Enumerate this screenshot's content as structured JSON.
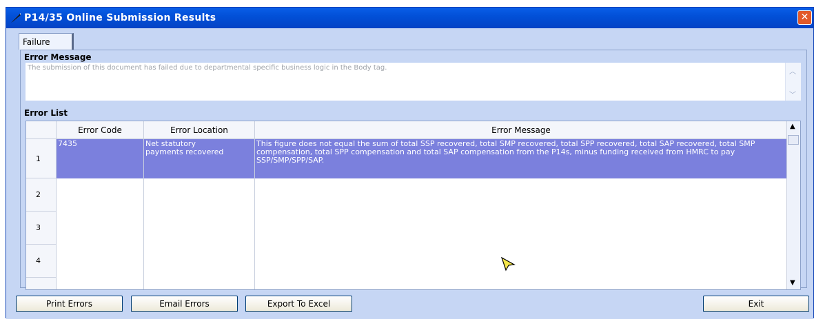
{
  "window": {
    "title": "P14/35 Online Submission Results",
    "close_label": "✕"
  },
  "tabs": [
    {
      "label": "Failure"
    }
  ],
  "error_message": {
    "label": "Error Message",
    "text": "The submission of this document has failed due to departmental specific business logic in the Body tag."
  },
  "error_list": {
    "label": "Error List",
    "columns": [
      "Error Code",
      "Error Location",
      "Error Message"
    ],
    "rows": [
      {
        "num": "1",
        "code": "7435",
        "location": "Net statutory payments recovered",
        "message": "This figure does not equal the sum of total SSP recovered, total SMP recovered, total SPP recovered, total SAP recovered, total SMP compensation, total SPP compensation and total SAP compensation from the P14s, minus funding received from HMRC to pay SSP/SMP/SPP/SAP."
      },
      {
        "num": "2",
        "code": "",
        "location": "",
        "message": ""
      },
      {
        "num": "3",
        "code": "",
        "location": "",
        "message": ""
      },
      {
        "num": "4",
        "code": "",
        "location": "",
        "message": ""
      }
    ]
  },
  "buttons": {
    "print": "Print Errors",
    "email": "Email Errors",
    "export": "Export To Excel",
    "exit": "Exit"
  },
  "colors": {
    "title_bar": "#0450d5",
    "selection": "#7b80dd",
    "panel": "#c6d6f4"
  },
  "icons": {
    "title": "quill-icon",
    "close": "close-icon",
    "up": "scroll-up-icon",
    "down": "scroll-down-icon"
  }
}
